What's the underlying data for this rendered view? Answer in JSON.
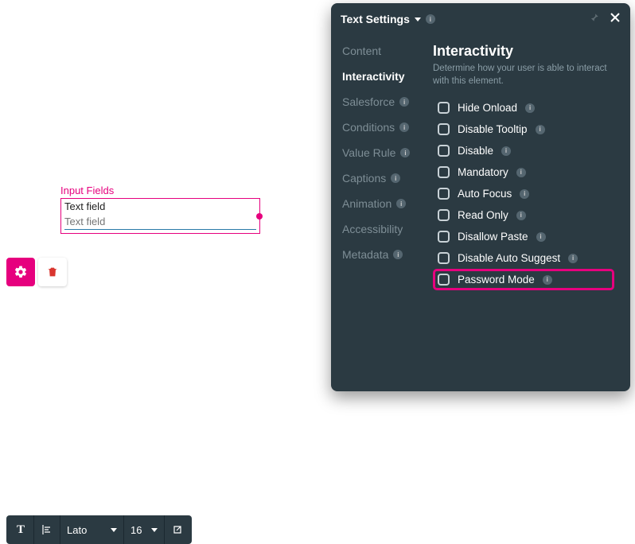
{
  "canvas": {
    "group_label": "Input Fields",
    "field_title": "Text field",
    "field_placeholder": "Text field"
  },
  "toolbar": {
    "font_family": "Lato",
    "font_size": "16"
  },
  "panel": {
    "title": "Text Settings",
    "sidebar": {
      "content": "Content",
      "interactivity": "Interactivity",
      "salesforce": "Salesforce",
      "conditions": "Conditions",
      "value_rule": "Value Rule",
      "captions": "Captions",
      "animation": "Animation",
      "accessibility": "Accessibility",
      "metadata": "Metadata"
    },
    "section_title": "Interactivity",
    "section_desc": "Determine how your user is able to interact with this element.",
    "options": {
      "hide_onload": "Hide Onload",
      "disable_tooltip": "Disable Tooltip",
      "disable": "Disable",
      "mandatory": "Mandatory",
      "auto_focus": "Auto Focus",
      "read_only": "Read Only",
      "disallow_paste": "Disallow Paste",
      "disable_auto_suggest": "Disable Auto Suggest",
      "password_mode": "Password Mode"
    }
  }
}
